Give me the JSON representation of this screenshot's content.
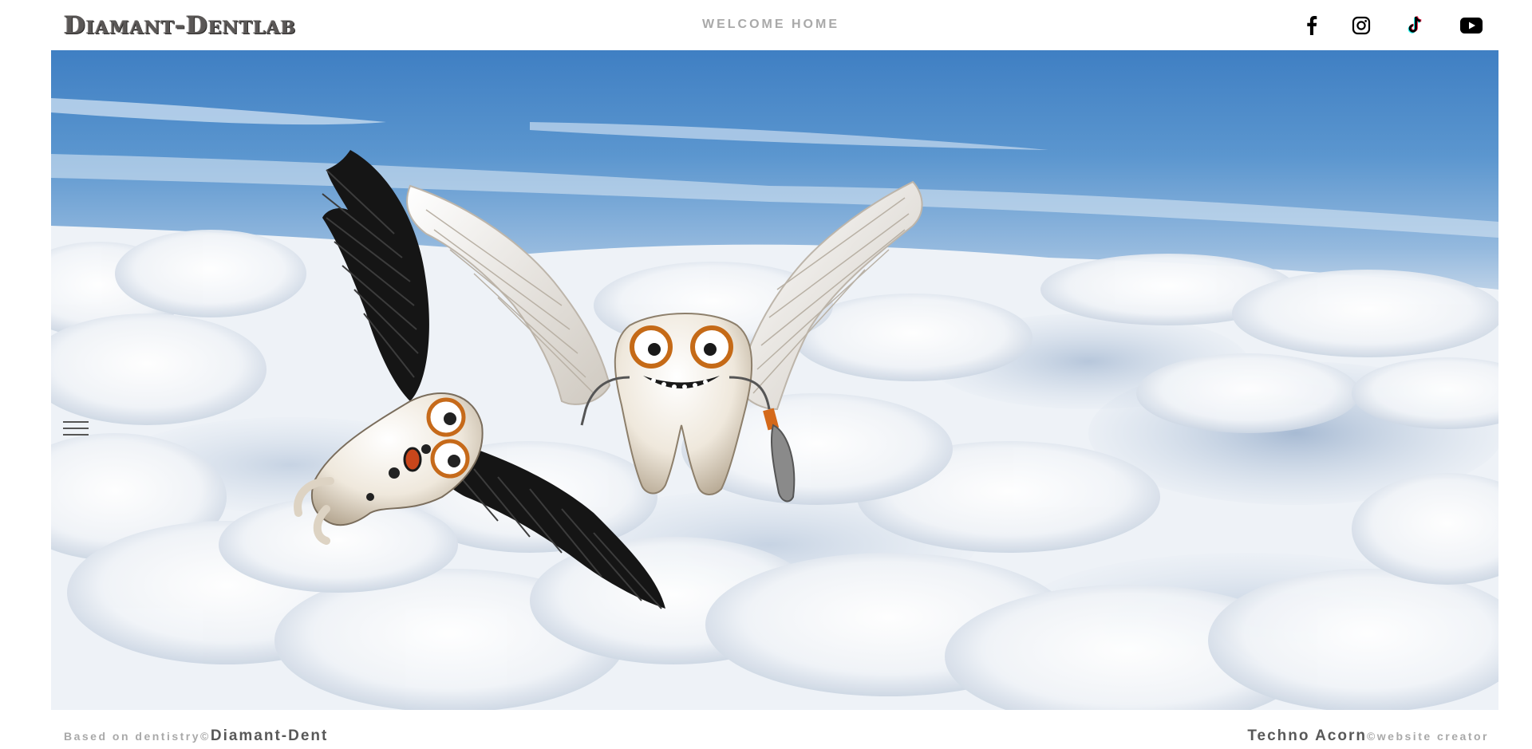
{
  "header": {
    "logo": "Diamant-Dentlab",
    "nav_link": "WELCOME HOME",
    "social": [
      {
        "name": "facebook-icon"
      },
      {
        "name": "instagram-icon"
      },
      {
        "name": "tiktok-icon"
      },
      {
        "name": "youtube-icon"
      }
    ]
  },
  "hero": {
    "image": "flying-teeth-angels-over-clouds",
    "menu_icon": "hamburger-menu-icon"
  },
  "footer": {
    "left_prefix": "Based on dentistry©",
    "left_brand": "Diamant-Dent",
    "right_brand": "Techno Acorn",
    "right_suffix": "©website creator"
  },
  "colors": {
    "sky_top": "#3f7fc0",
    "cloud": "#eef2f7",
    "text_muted": "#a9a9a9",
    "text_dark": "#585858",
    "logo": "#5a5756"
  }
}
